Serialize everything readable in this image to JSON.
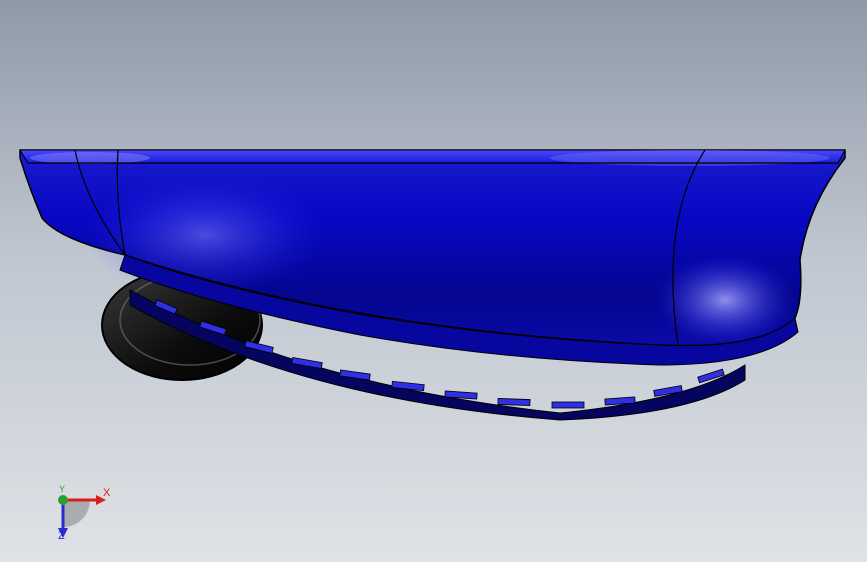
{
  "viewport": {
    "background_top": "#8f99a8",
    "background_bottom": "#dfe2e6"
  },
  "model": {
    "shell_color": "#0a0ab4",
    "wheel_color": "#111111"
  },
  "triad": {
    "x_label": "X",
    "y_label": "Y",
    "z_label": "Z",
    "x_color": "#d81e1e",
    "y_color": "#2e9e2e",
    "z_color": "#2a2ad0"
  }
}
